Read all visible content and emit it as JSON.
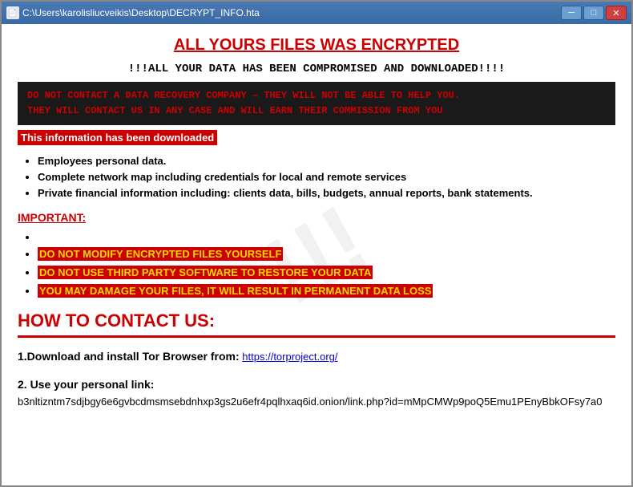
{
  "window": {
    "title": "C:\\Users\\karolisliucveikis\\Desktop\\DECRYPT_INFO.hta",
    "minimize_label": "─",
    "maximize_label": "□",
    "close_label": "✕"
  },
  "content": {
    "main_title": "ALL YOURS FILES WAS ENCRYPTED",
    "subtitle": "!!!ALL YOUR DATA HAS BEEN COMPROMISED AND DOWNLOADED!!!!",
    "warning_line1": "DO NOT CONTACT A DATA RECOVERY COMPANY – THEY WILL NOT BE ABLE TO HELP YOU.",
    "warning_line2": "THEY WILL CONTACT US IN ANY CASE AND WILL EARN THEIR COMMISSION FROM YOU",
    "info_downloaded": "This information has been downloaded",
    "bullet_items": [
      "Employees personal data.",
      "Complete network map including credentials for local and remote services",
      "Private financial information including: clients data, bills, budgets, annual reports, bank statements."
    ],
    "important_label": "IMPORTANT:",
    "warning_items": [
      "",
      "DO NOT MODIFY ENCRYPTED FILES YOURSELF",
      "DO NOT USE THIRD PARTY SOFTWARE TO RESTORE YOUR DATA",
      "YOU MAY DAMAGE YOUR FILES, IT WILL RESULT IN PERMANENT DATA LOSS"
    ],
    "how_to_contact_heading": "HOW TO CONTACT US:",
    "step1_label": "1.Download and install Tor Browser from:",
    "step1_link_text": "https://torproject.org/",
    "step1_link_url": "https://torproject.org/",
    "step2_label": "2. Use your personal link:",
    "step2_link": "b3nltizntm7sdjbgy6e6gvbcdmsmsebdnhxp3gs2u6efr4pqlhxaq6id.onion/link.php?id=mMpCMWp9poQ5Emu1PEnyBbkOFsy7a0",
    "watermark": "!!!"
  }
}
